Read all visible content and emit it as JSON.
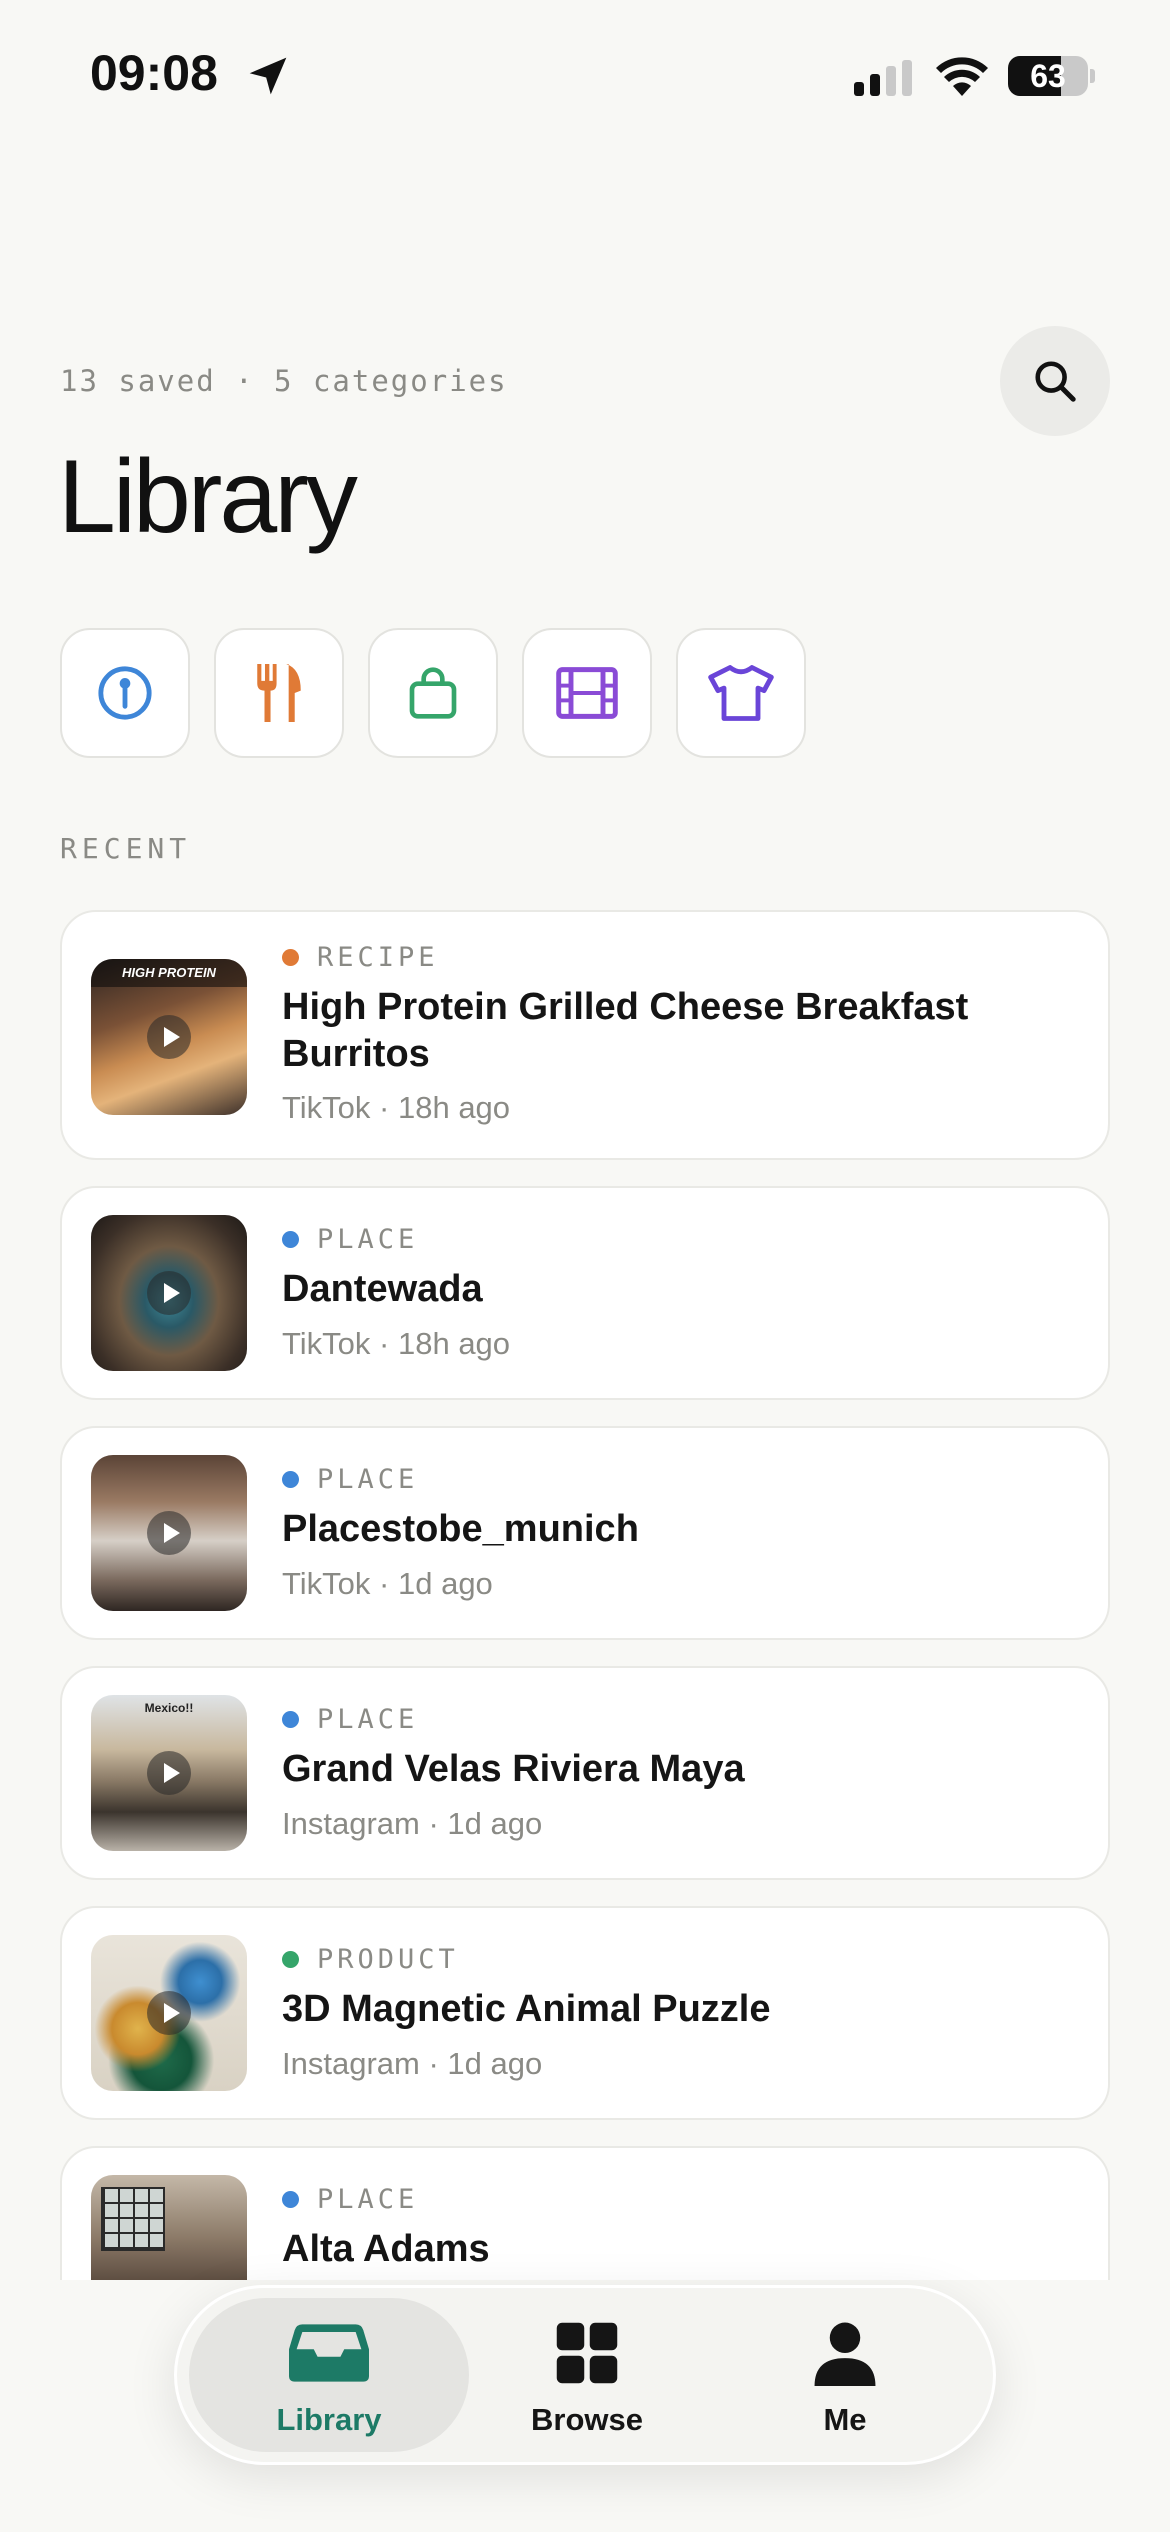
{
  "status_bar": {
    "time": "09:08",
    "battery": "63"
  },
  "header": {
    "summary": "13 saved · 5 categories",
    "title": "Library"
  },
  "category_chips": [
    {
      "icon": "pin-icon",
      "color": "#3e86d8"
    },
    {
      "icon": "fork-knife-icon",
      "color": "#e07a36"
    },
    {
      "icon": "shopping-bag-icon",
      "color": "#35a56a"
    },
    {
      "icon": "film-icon",
      "color": "#8a4bd6"
    },
    {
      "icon": "tshirt-icon",
      "color": "#6a45d8"
    }
  ],
  "recent": {
    "label": "RECENT",
    "items": [
      {
        "category": "RECIPE",
        "dot_color": "#e07a36",
        "title": "High Protein Grilled Cheese Breakfast Burritos",
        "source": "TikTok",
        "time": "18h ago",
        "thumb_caption": "HIGH PROTEIN"
      },
      {
        "category": "PLACE",
        "dot_color": "#3e86d8",
        "title": "Dantewada",
        "source": "TikTok",
        "time": "18h ago"
      },
      {
        "category": "PLACE",
        "dot_color": "#3e86d8",
        "title": "Placestobe_munich",
        "source": "TikTok",
        "time": "1d ago"
      },
      {
        "category": "PLACE",
        "dot_color": "#3e86d8",
        "title": "Grand Velas Riviera Maya",
        "source": "Instagram",
        "time": "1d ago",
        "thumb_caption": "Mexico!!"
      },
      {
        "category": "PRODUCT",
        "dot_color": "#35a56a",
        "title": "3D Magnetic Animal Puzzle",
        "source": "Instagram",
        "time": "1d ago"
      },
      {
        "category": "PLACE",
        "dot_color": "#3e86d8",
        "title": "Alta Adams",
        "source": "",
        "time": ""
      }
    ]
  },
  "tabbar": {
    "tabs": [
      {
        "label": "Library",
        "active": true
      },
      {
        "label": "Browse",
        "active": false
      },
      {
        "label": "Me",
        "active": false
      }
    ]
  },
  "colors": {
    "accent": "#1d7a66",
    "background": "#f8f8f5"
  }
}
